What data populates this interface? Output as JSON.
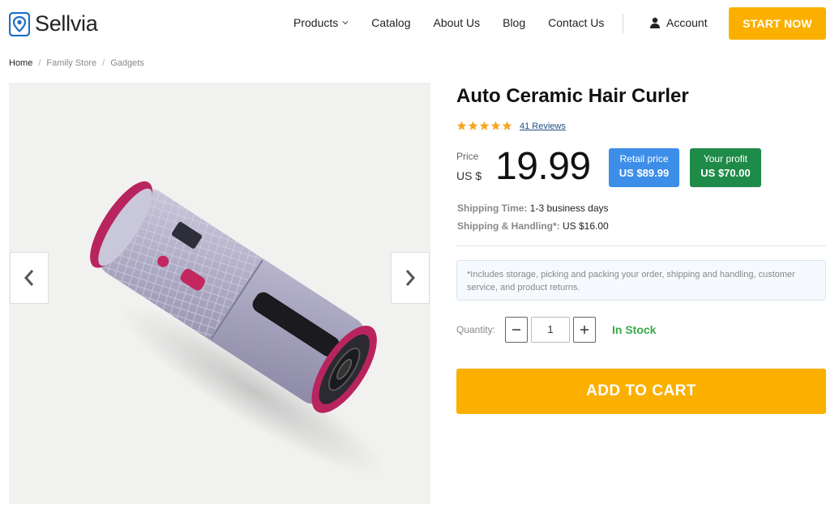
{
  "brand": {
    "name": "Sellvia",
    "accent": "#fbb000",
    "logo_color": "#1f6fc4"
  },
  "nav": {
    "items": [
      {
        "label": "Products",
        "has_dropdown": true
      },
      {
        "label": "Catalog"
      },
      {
        "label": "About Us"
      },
      {
        "label": "Blog"
      },
      {
        "label": "Contact Us"
      }
    ],
    "account_label": "Account",
    "cta_label": "START NOW"
  },
  "breadcrumb": [
    "Home",
    "Family Store",
    "Gadgets"
  ],
  "product": {
    "title": "Auto Ceramic Hair Curler",
    "rating": 5,
    "reviews_label": "41 Reviews",
    "price_label": "Price",
    "currency": "US $",
    "price": "19.99",
    "retail": {
      "label": "Retail price",
      "value": "US $89.99",
      "color": "#3d8ee8"
    },
    "profit": {
      "label": "Your profit",
      "value": "US $70.00",
      "color": "#1e8b48"
    },
    "shipping_time": {
      "label": "Shipping Time:",
      "value": "1-3 business days"
    },
    "shipping_handling": {
      "label": "Shipping & Handling*:",
      "value": "US $16.00"
    },
    "notice": "*Includes storage, picking and packing your order, shipping and handling, customer service, and product returns.",
    "quantity_label": "Quantity:",
    "quantity": "1",
    "stock": "In Stock",
    "add_to_cart": "ADD TO CART"
  }
}
